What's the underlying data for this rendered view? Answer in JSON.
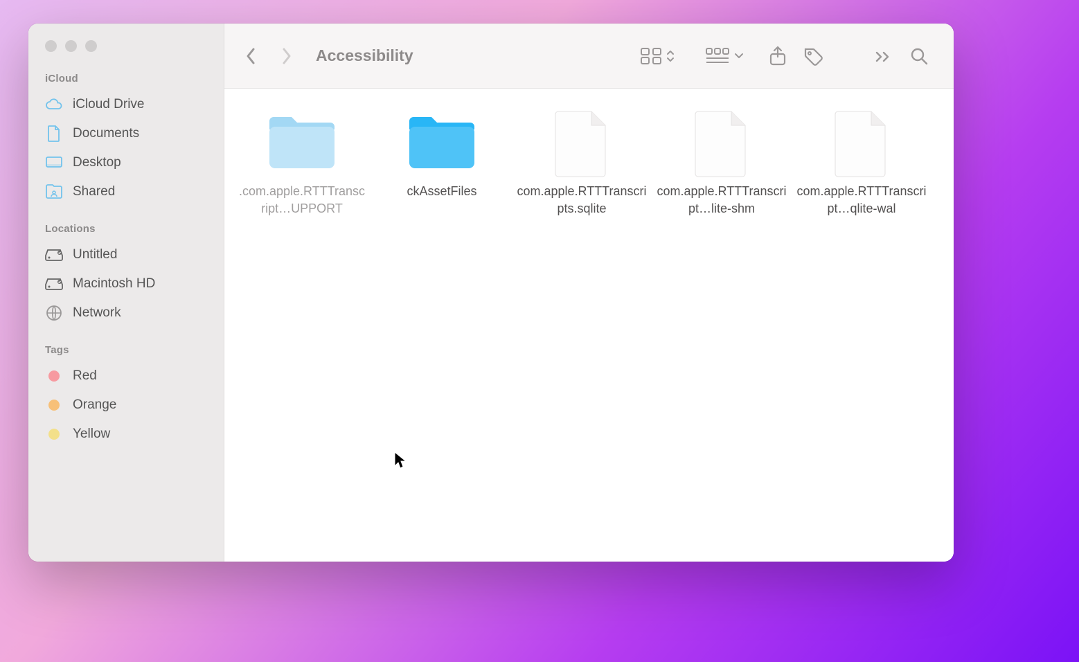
{
  "window": {
    "title": "Accessibility"
  },
  "sidebar": {
    "sections": [
      {
        "label": "iCloud",
        "items": [
          {
            "icon": "cloud",
            "label": "iCloud Drive"
          },
          {
            "icon": "document",
            "label": "Documents"
          },
          {
            "icon": "desktop",
            "label": "Desktop"
          },
          {
            "icon": "shared",
            "label": "Shared"
          }
        ]
      },
      {
        "label": "Locations",
        "items": [
          {
            "icon": "disk",
            "label": "Untitled"
          },
          {
            "icon": "disk",
            "label": "Macintosh HD"
          },
          {
            "icon": "globe",
            "label": "Network"
          }
        ]
      },
      {
        "label": "Tags",
        "items": [
          {
            "icon": "tag",
            "label": "Red",
            "color": "#f79aa0"
          },
          {
            "icon": "tag",
            "label": "Orange",
            "color": "#f7c078"
          },
          {
            "icon": "tag",
            "label": "Yellow",
            "color": "#f3e08a"
          }
        ]
      }
    ]
  },
  "items": [
    {
      "type": "folder-dim",
      "name": ".com.apple.RTTTranscript…UPPORT"
    },
    {
      "type": "folder-sel",
      "name": "ckAssetFiles"
    },
    {
      "type": "file",
      "name": "com.apple.RTTTranscripts.sqlite"
    },
    {
      "type": "file",
      "name": "com.apple.RTTTranscript…lite-shm"
    },
    {
      "type": "file",
      "name": "com.apple.RTTTranscript…qlite-wal"
    }
  ]
}
